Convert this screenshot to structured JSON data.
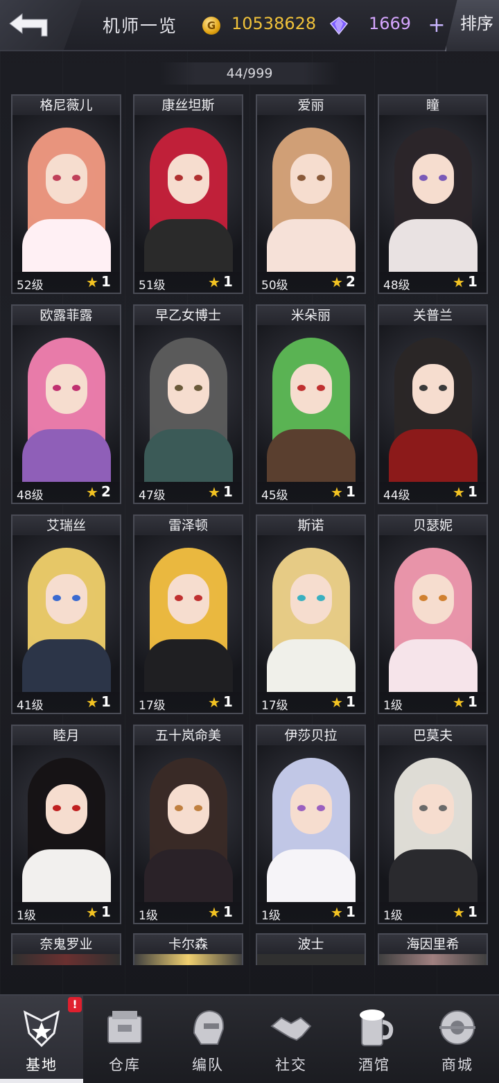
{
  "header": {
    "title": "机师一览",
    "coins": "10538628",
    "gems": "1669",
    "add_label": "+",
    "sort_label": "排序"
  },
  "pilot_count": "44/999",
  "icons": {
    "back": "back-arrow-icon",
    "coin": "coin-icon",
    "gem": "diamond-gem-icon",
    "star": "star-icon"
  },
  "colors": {
    "coin": "#f0c23a",
    "gem": "#d6a6ff",
    "star": "#f3c322",
    "alert": "#e0202e"
  },
  "pilots": [
    {
      "name": "格尼薇儿",
      "level": "52级",
      "stars": "1"
    },
    {
      "name": "康丝坦斯",
      "level": "51级",
      "stars": "1"
    },
    {
      "name": "爱丽",
      "level": "50级",
      "stars": "2"
    },
    {
      "name": "瞳",
      "level": "48级",
      "stars": "1"
    },
    {
      "name": "欧露菲露",
      "level": "48级",
      "stars": "2"
    },
    {
      "name": "早乙女博士",
      "level": "47级",
      "stars": "1"
    },
    {
      "name": "米朵丽",
      "level": "45级",
      "stars": "1"
    },
    {
      "name": "关普兰",
      "level": "44级",
      "stars": "1"
    },
    {
      "name": "艾瑞丝",
      "level": "41级",
      "stars": "1"
    },
    {
      "name": "雷泽顿",
      "level": "17级",
      "stars": "1"
    },
    {
      "name": "斯诺",
      "level": "17级",
      "stars": "1"
    },
    {
      "name": "贝瑟妮",
      "level": "1级",
      "stars": "1"
    },
    {
      "name": "睦月",
      "level": "1级",
      "stars": "1"
    },
    {
      "name": "五十岚命美",
      "level": "1级",
      "stars": "1"
    },
    {
      "name": "伊莎贝拉",
      "level": "1级",
      "stars": "1"
    },
    {
      "name": "巴莫夫",
      "level": "1级",
      "stars": "1"
    },
    {
      "name": "奈鬼罗业"
    },
    {
      "name": "卡尔森"
    },
    {
      "name": "波士"
    },
    {
      "name": "海因里希"
    }
  ],
  "nav": [
    {
      "label": "基地",
      "icon": "base-emblem-icon",
      "active": true,
      "alert": "!"
    },
    {
      "label": "仓库",
      "icon": "warehouse-crate-icon"
    },
    {
      "label": "编队",
      "icon": "formation-helmet-icon"
    },
    {
      "label": "社交",
      "icon": "handshake-icon"
    },
    {
      "label": "酒馆",
      "icon": "tavern-mug-icon"
    },
    {
      "label": "商城",
      "icon": "shop-capsule-icon"
    }
  ]
}
